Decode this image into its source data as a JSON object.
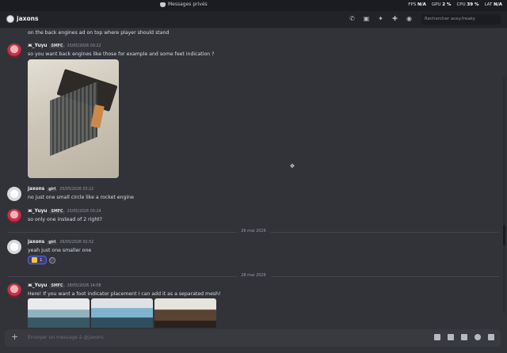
{
  "titlebar": {
    "title": "Messages privés"
  },
  "overlay": {
    "fps_label": "FPS",
    "fps_value": "N/A",
    "gpu_label": "GPU",
    "gpu_value": "2 %",
    "cpu_label": "CPU",
    "cpu_value": "39 %",
    "lat_label": "LAT",
    "lat_value": "N/A"
  },
  "header": {
    "username": "jaxons",
    "search_placeholder": "Rechercher acey.freaky",
    "icons": [
      "phone-icon",
      "video-icon",
      "pin-icon",
      "add-friend-icon",
      "profile-icon"
    ]
  },
  "messages": [
    {
      "text": "on the back engines ad on top where player should stand"
    },
    {
      "author": "ж_Yuyu",
      "tag": "SMFC",
      "timestamp": "25/05/2026 03:22",
      "text": "so you want back engines like those for example and some feet indication ?"
    },
    {
      "author": "jaxons",
      "tag": "girl",
      "timestamp": "25/05/2026 03:22",
      "text": "no just one small circle like a rocket engine"
    },
    {
      "author": "ж_Yuyu",
      "tag": "SMFC",
      "timestamp": "25/05/2026 03:24",
      "text": "so only one instead of 2 right?"
    },
    {
      "author": "jaxons",
      "tag": "girl",
      "timestamp": "26/05/2026 02:52",
      "text": "yeah just one smaller one",
      "reaction_count": "1"
    },
    {
      "author": "ж_Yuyu",
      "tag": "SMFC",
      "timestamp": "28/05/2026 14:08",
      "text": "Here! If you want a foot indicator placement I can add it as a separated mesh!"
    }
  ],
  "dividers": {
    "d1": "26 mai 2026",
    "d2": "28 mai 2026"
  },
  "composer": {
    "placeholder": "Envoyer un message à @jaxons"
  }
}
